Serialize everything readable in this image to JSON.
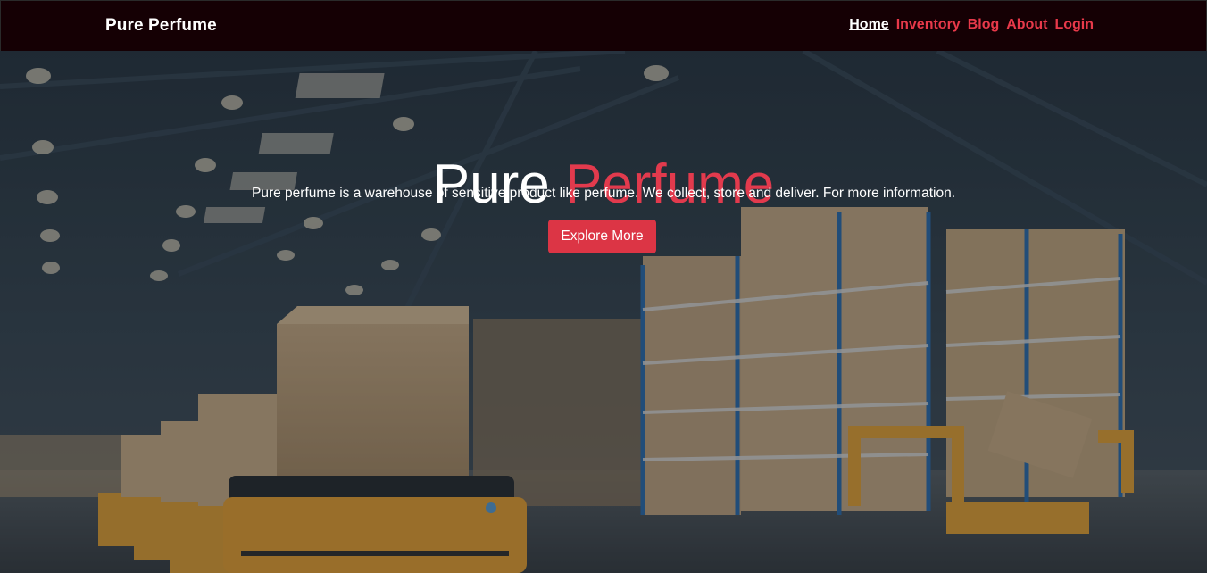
{
  "navbar": {
    "brand": "Pure Perfume",
    "links": [
      {
        "label": "Home",
        "active": true
      },
      {
        "label": "Inventory"
      },
      {
        "label": "Blog"
      },
      {
        "label": "About"
      },
      {
        "label": "Login"
      }
    ]
  },
  "hero": {
    "title_part1": "Pure",
    "title_part2": "Perfume",
    "description": "Pure perfume is a warehouse of sensitive product like perfume. We collect, store and deliver. For more information.",
    "button_label": "Explore More",
    "background": "warehouse with shelves of boxes and robotic carts"
  },
  "colors": {
    "navbar_bg": "#150004",
    "accent": "#dc3545",
    "text": "#ffffff"
  }
}
